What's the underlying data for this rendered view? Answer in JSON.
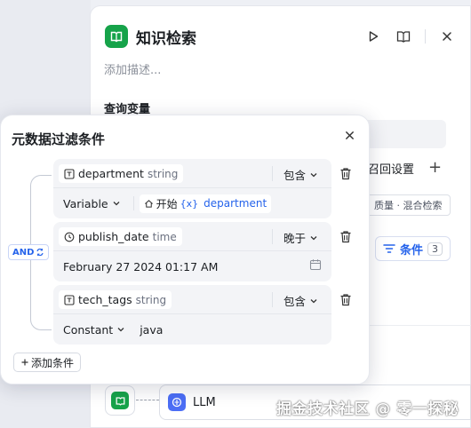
{
  "panel": {
    "title": "知识检索",
    "description_placeholder": "添加描述...",
    "query_section": "查询变量",
    "recall_settings": "召回设置",
    "recall_plus": "+",
    "recall_tag": "质量 · 混合检索",
    "conditions_button": "条件",
    "conditions_count": "3"
  },
  "flow": {
    "llm_label": "LLM"
  },
  "watermark": "掘金技术社区 @ 零一探秘",
  "modal": {
    "title": "元数据过滤条件",
    "logic": "AND",
    "add_condition": "添加条件",
    "conditions": [
      {
        "field": "department",
        "type": "string",
        "operator": "包含",
        "value_type": "Variable",
        "ref_node": "开始",
        "ref_bracket": "{x}",
        "ref_var": "department"
      },
      {
        "field": "publish_date",
        "type": "time",
        "operator": "晚于",
        "value": "February 27 2024 01:17 AM"
      },
      {
        "field": "tech_tags",
        "type": "string",
        "operator": "包含",
        "value_type": "Constant",
        "value": "java"
      }
    ]
  },
  "colors": {
    "accent": "#2563eb",
    "node_green": "#16a34a"
  }
}
